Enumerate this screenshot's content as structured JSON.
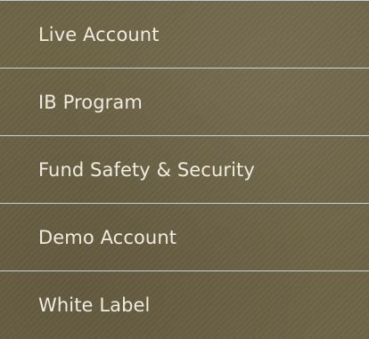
{
  "menu": {
    "items": [
      {
        "label": "Live Account"
      },
      {
        "label": "IB Program"
      },
      {
        "label": "Fund Safety & Security"
      },
      {
        "label": "Demo Account"
      },
      {
        "label": "White Label"
      }
    ]
  },
  "colors": {
    "background": "#6e6447",
    "text": "#efebe0",
    "divider": "#ffffff"
  }
}
